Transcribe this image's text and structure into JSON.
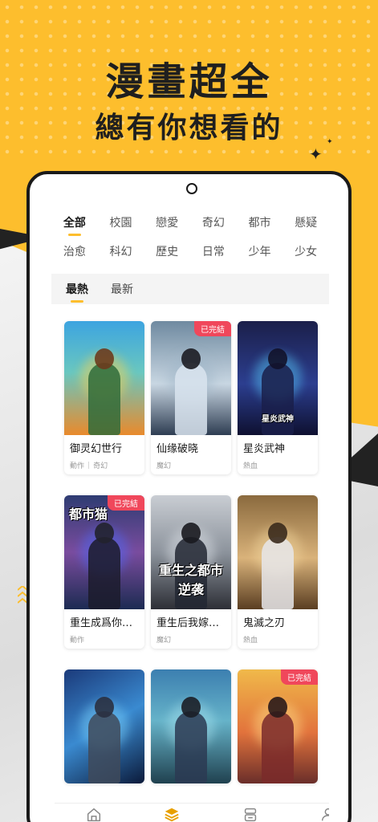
{
  "promo": {
    "headline_1": "漫畫超全",
    "headline_2": "總有你想看的"
  },
  "categories": [
    "全部",
    "校園",
    "戀愛",
    "奇幻",
    "都市",
    "懸疑",
    "治愈",
    "科幻",
    "歷史",
    "日常",
    "少年",
    "少女"
  ],
  "active_category": "全部",
  "sort_tabs": [
    "最熱",
    "最新"
  ],
  "active_sort": "最熱",
  "comics": [
    {
      "title": "御灵幻世行",
      "tags": [
        "動作",
        "奇幻"
      ],
      "badge": "",
      "cover_text": ""
    },
    {
      "title": "仙缘破晓",
      "tags": [
        "魔幻"
      ],
      "badge": "已完結",
      "cover_text": ""
    },
    {
      "title": "星炎武神",
      "tags": [
        "熱血"
      ],
      "badge": "",
      "cover_text": "星炎武神"
    },
    {
      "title": "重生成爲你的…",
      "tags": [
        "動作"
      ],
      "badge": "已完結",
      "cover_text": "都市猫"
    },
    {
      "title": "重生后我嫁給…",
      "tags": [
        "魔幻"
      ],
      "badge": "",
      "cover_text": "重生之都市逆袭"
    },
    {
      "title": "鬼滅之刃",
      "tags": [
        "熱血"
      ],
      "badge": "",
      "cover_text": ""
    },
    {
      "title": "",
      "tags": [],
      "badge": "",
      "cover_text": ""
    },
    {
      "title": "",
      "tags": [],
      "badge": "",
      "cover_text": ""
    },
    {
      "title": "",
      "tags": [],
      "badge": "已完結",
      "cover_text": ""
    }
  ],
  "tabbar": [
    {
      "label": "首頁",
      "icon": "home-icon"
    },
    {
      "label": "分類",
      "icon": "category-icon"
    },
    {
      "label": "書架",
      "icon": "bookshelf-icon"
    },
    {
      "label": "我的",
      "icon": "profile-icon"
    }
  ],
  "active_tab": "分類",
  "colors": {
    "brand_yellow": "#FDBE2D",
    "badge_red": "#F0475B",
    "active_tab": "#E8A000"
  }
}
